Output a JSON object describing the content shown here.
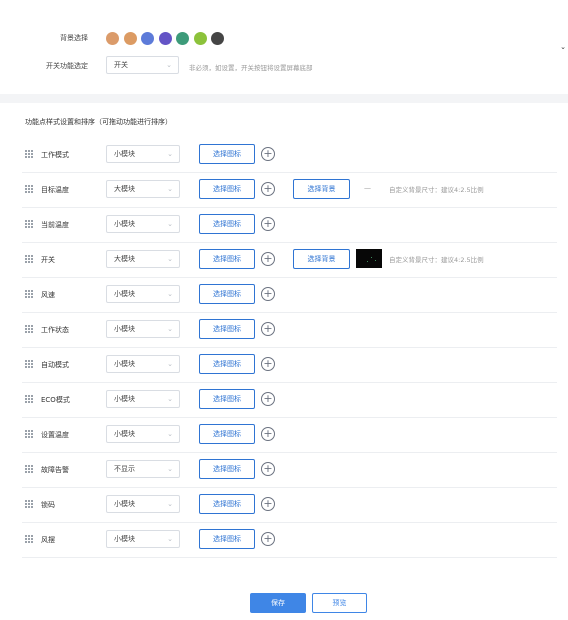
{
  "header": {
    "bg_label": "背景选择",
    "bg_colors": [
      "#db9b6a",
      "#dc9b63",
      "#5d7bd9",
      "#6454c6",
      "#3d9b7a",
      "#8cc23b",
      "#454545"
    ],
    "switch_label": "开关功能选定",
    "switch_value": "开关",
    "switch_hint": "非必须，如设置，开关按钮将设置屏幕底部"
  },
  "section_title": "功能点样式设置和排序（可拖动功能进行排序）",
  "rows": [
    {
      "name": "工作模式",
      "style": "小模块",
      "icon_btn": "选择图标"
    },
    {
      "name": "目标温度",
      "style": "大模块",
      "icon_btn": "选择图标",
      "bg_btn": "选择背景",
      "bg_dash": "—",
      "bg_hint": "自定义背景尺寸：建议4:2.5比例"
    },
    {
      "name": "当前温度",
      "style": "小模块",
      "icon_btn": "选择图标"
    },
    {
      "name": "开关",
      "style": "大模块",
      "icon_btn": "选择图标",
      "bg_btn": "选择背景",
      "bg_hint": "自定义背景尺寸：建议4:2.5比例"
    },
    {
      "name": "风速",
      "style": "小模块",
      "icon_btn": "选择图标"
    },
    {
      "name": "工作状态",
      "style": "小模块",
      "icon_btn": "选择图标"
    },
    {
      "name": "自动模式",
      "style": "小模块",
      "icon_btn": "选择图标"
    },
    {
      "name": "ECO模式",
      "style": "小模块",
      "icon_btn": "选择图标"
    },
    {
      "name": "设置温度",
      "style": "小模块",
      "icon_btn": "选择图标"
    },
    {
      "name": "故障告警",
      "style": "不显示",
      "icon_btn": "选择图标"
    },
    {
      "name": "锁码",
      "style": "小模块",
      "icon_btn": "选择图标"
    },
    {
      "name": "风摆",
      "style": "小模块",
      "icon_btn": "选择图标"
    }
  ],
  "footer": {
    "save": "保存",
    "preview": "预览"
  }
}
